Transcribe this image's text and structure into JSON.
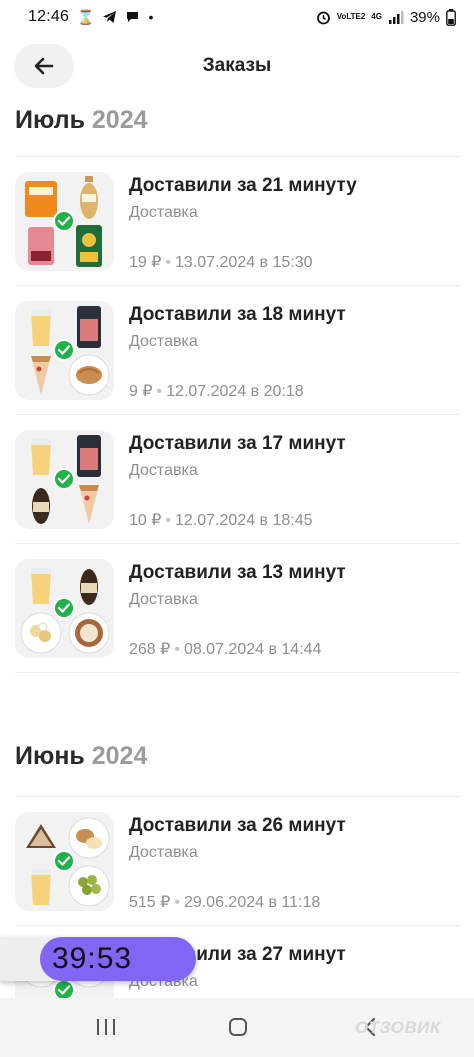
{
  "status_bar": {
    "time": "12:46",
    "network": "VoLTE2",
    "network_type": "4G",
    "battery": "39%"
  },
  "header": {
    "title": "Заказы",
    "back_icon": "arrow-left-icon"
  },
  "sections": [
    {
      "month": "Июль",
      "year": "2024"
    },
    {
      "month": "Июнь",
      "year": "2024"
    }
  ],
  "orders": [
    {
      "title": "Доставили за 21 минуту",
      "type": "Доставка",
      "price": "19 ₽",
      "date": "13.07.2024 в 15:30"
    },
    {
      "title": "Доставили за 18 минут",
      "type": "Доставка",
      "price": "9 ₽",
      "date": "12.07.2024 в 20:18"
    },
    {
      "title": "Доставили за 17 минут",
      "type": "Доставка",
      "price": "10 ₽",
      "date": "12.07.2024 в 18:45"
    },
    {
      "title": "Доставили за 13 минут",
      "type": "Доставка",
      "price": "268 ₽",
      "date": "08.07.2024 в 14:44"
    },
    {
      "title": "Доставили за 26 минут",
      "type": "Доставка",
      "price": "515 ₽",
      "date": "29.06.2024 в 11:18"
    },
    {
      "title": "Доставили за 27 минут",
      "type": "Доставка"
    }
  ],
  "timer": {
    "value": "39:53"
  },
  "watermark": "ОТЗОВИК",
  "colors": {
    "accent_green": "#21b24b",
    "timer_purple": "#8066f3",
    "muted_text": "#8f8f8f"
  }
}
